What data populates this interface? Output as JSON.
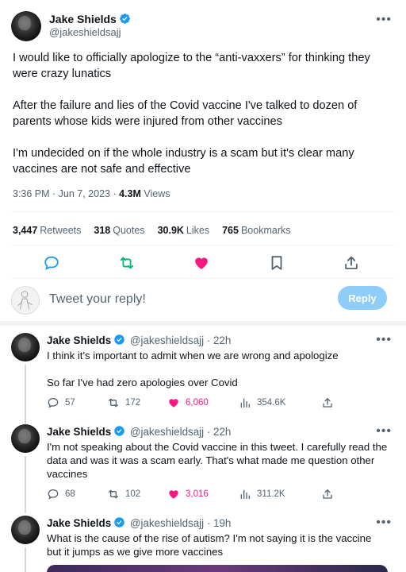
{
  "tweet": {
    "author_name": "Jake Shields",
    "author_handle": "@jakeshieldsajj",
    "paragraphs": [
      "I would like to officially apologize to the “anti-vaxxers” for thinking they were crazy lunatics",
      "After the failure and lies of the Covid vaccine I've talked to dozen of parents whose kids were injured from other vaccines",
      "I'm  undecided on if the whole industry is a scam but it's clear many vaccines are not safe and effective"
    ],
    "time": "3:36 PM · Jun 7, 2023 · ",
    "views_count": "4.3M",
    "views_label": " Views",
    "stats": {
      "retweets_count": "3,447",
      "retweets_label": "Retweets",
      "quotes_count": "318",
      "quotes_label": "Quotes",
      "likes_count": "30.9K",
      "likes_label": "Likes",
      "bookmarks_count": "765",
      "bookmarks_label": "Bookmarks"
    }
  },
  "reply_box": {
    "placeholder": "Tweet your reply!",
    "button_label": "Reply"
  },
  "replies": [
    {
      "name": "Jake Shields",
      "handle": "@jakeshieldsajj · 22h",
      "paragraphs": [
        "I think it's important to admit when we are wrong and apologize",
        "So far I've had zero apologies over Covid"
      ],
      "replies": "57",
      "retweets": "172",
      "likes": "6,060",
      "views": "354.6K"
    },
    {
      "name": "Jake Shields",
      "handle": "@jakeshieldsajj · 22h",
      "paragraphs": [
        "I'm not speaking about the Covid vaccine in this tweet.  I carefully read the data and was it was a scam early.  That's what made me question other vaccines"
      ],
      "replies": "68",
      "retweets": "102",
      "likes": "3,016",
      "views": "311.2K"
    },
    {
      "name": "Jake Shields",
      "handle": "@jakeshieldsajj · 19h",
      "paragraphs": [
        "What is the cause of the rise of autism?  I'm not saying it is the vaccine but it jumps as we give more vaccines"
      ]
    }
  ],
  "colors": {
    "accent": "#1d9bf0",
    "like": "#f91880",
    "retweet": "#00ba7c",
    "muted": "#536471"
  },
  "icons": [
    "verified-badge-icon",
    "more-icon",
    "reply-icon",
    "retweet-icon",
    "like-icon",
    "bookmark-icon",
    "share-icon",
    "views-icon"
  ]
}
